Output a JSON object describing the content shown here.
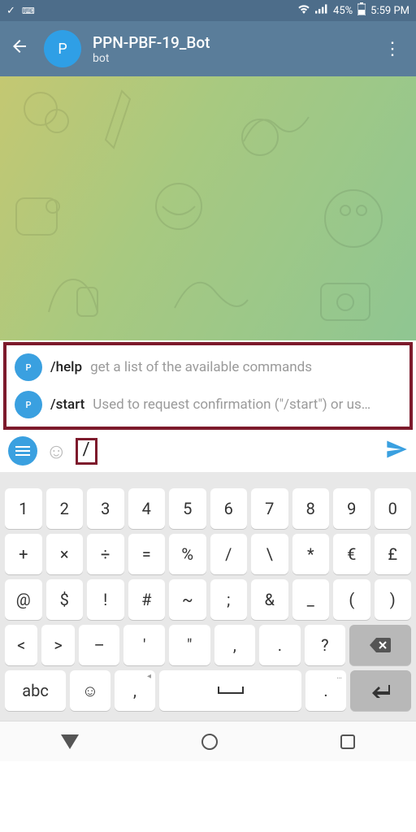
{
  "status": {
    "battery": "45%",
    "time": "5:59 PM"
  },
  "header": {
    "title": "PPN-PBF-19_Bot",
    "subtitle": "bot",
    "avatar_initial": "P"
  },
  "commands": [
    {
      "avatar": "P",
      "name": "/help",
      "desc": "get a list of the available commands"
    },
    {
      "avatar": "P",
      "name": "/start",
      "desc": "Used to request confirmation (\"/start\") or us…"
    }
  ],
  "input": {
    "value": "/"
  },
  "keyboard": {
    "row1": [
      "1",
      "2",
      "3",
      "4",
      "5",
      "6",
      "7",
      "8",
      "9",
      "0"
    ],
    "row2": [
      "+",
      "×",
      "÷",
      "=",
      "%",
      "/",
      "\\",
      "*",
      "€",
      "£"
    ],
    "row3": [
      "@",
      "$",
      "!",
      "#",
      "~",
      ";",
      "&",
      "_",
      "(",
      ")"
    ],
    "row4_left": [
      "<",
      ">"
    ],
    "row4_mid": [
      "–",
      "'",
      "\"",
      ",",
      ".",
      "?"
    ],
    "row5_abc": "abc"
  }
}
